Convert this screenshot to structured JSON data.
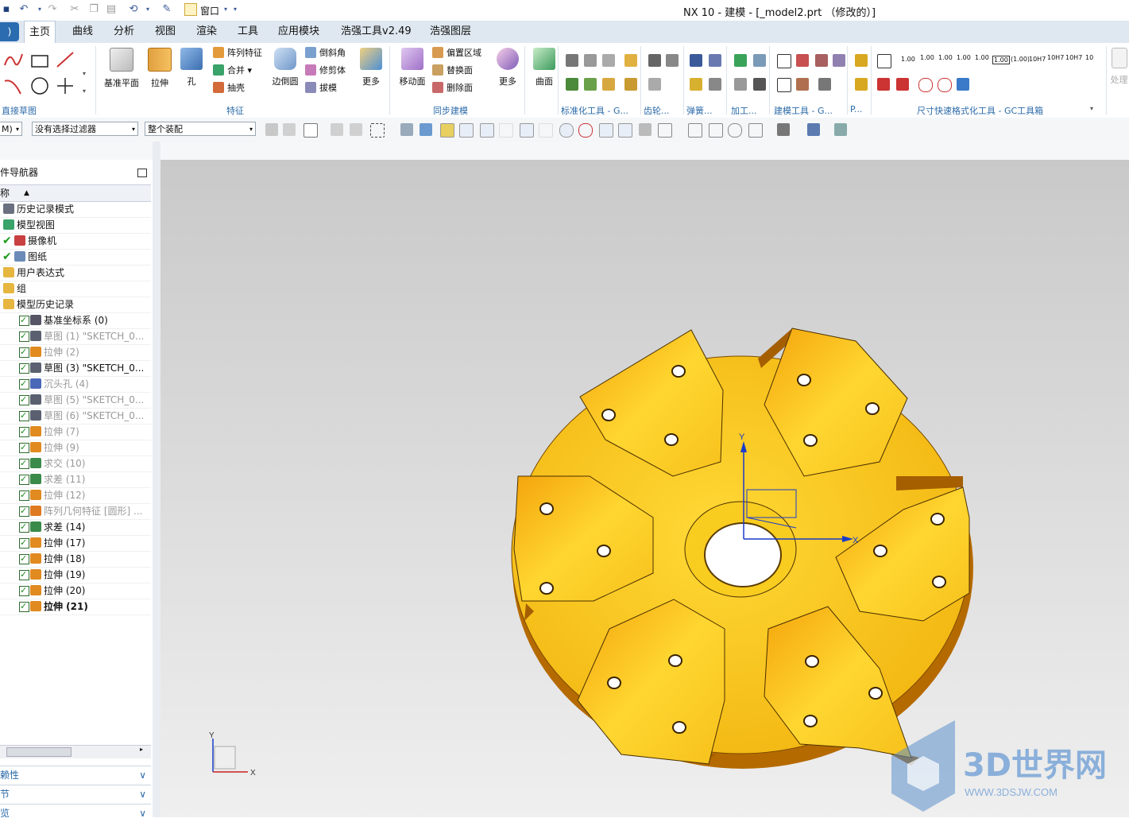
{
  "window": {
    "title": "NX 10 - 建模 - [_model2.prt （修改的）]"
  },
  "quick_access": {
    "window_menu": "窗口"
  },
  "tabs": [
    "主页",
    "曲线",
    "分析",
    "视图",
    "渲染",
    "工具",
    "应用模块",
    "浩强工具v2.49",
    "浩强图层"
  ],
  "active_tab": "主页",
  "ribbon": {
    "groups": {
      "direct_sketch": "直接草图",
      "feature": "特征",
      "sync_modeling": "同步建模",
      "std_tools": "标准化工具 - G...",
      "gear": "齿轮...",
      "spring": "弹簧...",
      "machining": "加工...",
      "model_tools": "建模工具 - G...",
      "p": "P...",
      "dim_tools": "尺寸快速格式化工具 - GC工具箱"
    },
    "buttons": {
      "datum_plane": "基准平面",
      "extrude": "拉伸",
      "hole": "孔",
      "pattern_feature": "阵列特征",
      "unite": "合并",
      "shell": "抽壳",
      "edge_blend": "边倒圆",
      "chamfer": "倒斜角",
      "trim_body": "修剪体",
      "draft": "拔模",
      "more1": "更多",
      "move_face": "移动面",
      "offset_region": "偏置区域",
      "replace_face": "替换面",
      "delete_face": "删除面",
      "more2": "更多",
      "surface": "曲面",
      "process": "处理"
    },
    "dim_formats": [
      "1.00",
      "1.00",
      "1.00",
      "1.00",
      "1.00",
      "1.00",
      "(1.00)",
      "10H7",
      "10H7",
      "10H7",
      "10"
    ]
  },
  "selection_bar": {
    "menu_label": "M)",
    "filter_value": "没有选择过滤器",
    "scope_value": "整个装配"
  },
  "navigator": {
    "title": "件导航器",
    "column_name": "称",
    "rows": [
      {
        "label": "历史记录模式",
        "type": "clock",
        "level": 0
      },
      {
        "label": "模型视图",
        "type": "views",
        "level": 0
      },
      {
        "label": "摄像机",
        "type": "camera",
        "level": 0,
        "checked": true
      },
      {
        "label": "图纸",
        "type": "drawing",
        "level": 0,
        "checked": true
      },
      {
        "label": "用户表达式",
        "type": "folder",
        "level": 0
      },
      {
        "label": "组",
        "type": "folder",
        "level": 0
      },
      {
        "label": "模型历史记录",
        "type": "folder",
        "level": 0
      },
      {
        "label": "基准坐标系 (0)",
        "type": "csys",
        "level": 1
      },
      {
        "label": "草图 (1) \"SKETCH_0...",
        "type": "sketch",
        "level": 1,
        "dim": true
      },
      {
        "label": "拉伸 (2)",
        "type": "extrude",
        "level": 1,
        "dim": true
      },
      {
        "label": "草图 (3) \"SKETCH_0...",
        "type": "sketch",
        "level": 1
      },
      {
        "label": "沉头孔 (4)",
        "type": "hole",
        "level": 1,
        "dim": true
      },
      {
        "label": "草图 (5) \"SKETCH_0...",
        "type": "sketch",
        "level": 1,
        "dim": true
      },
      {
        "label": "草图 (6) \"SKETCH_0...",
        "type": "sketch",
        "level": 1,
        "dim": true
      },
      {
        "label": "拉伸 (7)",
        "type": "extrude",
        "level": 1,
        "dim": true
      },
      {
        "label": "拉伸 (9)",
        "type": "extrude",
        "level": 1,
        "dim": true
      },
      {
        "label": "求交 (10)",
        "type": "bool",
        "level": 1,
        "dim": true
      },
      {
        "label": "求差 (11)",
        "type": "bool",
        "level": 1,
        "dim": true
      },
      {
        "label": "拉伸 (12)",
        "type": "extrude",
        "level": 1,
        "dim": true
      },
      {
        "label": "阵列几何特征 [圆形] ...",
        "type": "pattern",
        "level": 1,
        "dim": true
      },
      {
        "label": "求差 (14)",
        "type": "bool",
        "level": 1
      },
      {
        "label": "拉伸 (17)",
        "type": "extrude",
        "level": 1
      },
      {
        "label": "拉伸 (18)",
        "type": "extrude",
        "level": 1
      },
      {
        "label": "拉伸 (19)",
        "type": "extrude",
        "level": 1
      },
      {
        "label": "拉伸 (20)",
        "type": "extrude",
        "level": 1
      },
      {
        "label": "拉伸 (21)",
        "type": "extrude",
        "level": 1,
        "bold": true
      }
    ],
    "panels": [
      "相依性",
      "细节",
      "预览"
    ],
    "panel_visible": [
      "赖性",
      "节",
      "览"
    ]
  },
  "viewport": {
    "axis_x": "X",
    "axis_y": "Y",
    "mini_x": "X",
    "mini_y": "Y",
    "watermark_title": "3D世界网",
    "watermark_url": "WWW.3DSJW.COM",
    "model_color": "#f6bf16"
  }
}
